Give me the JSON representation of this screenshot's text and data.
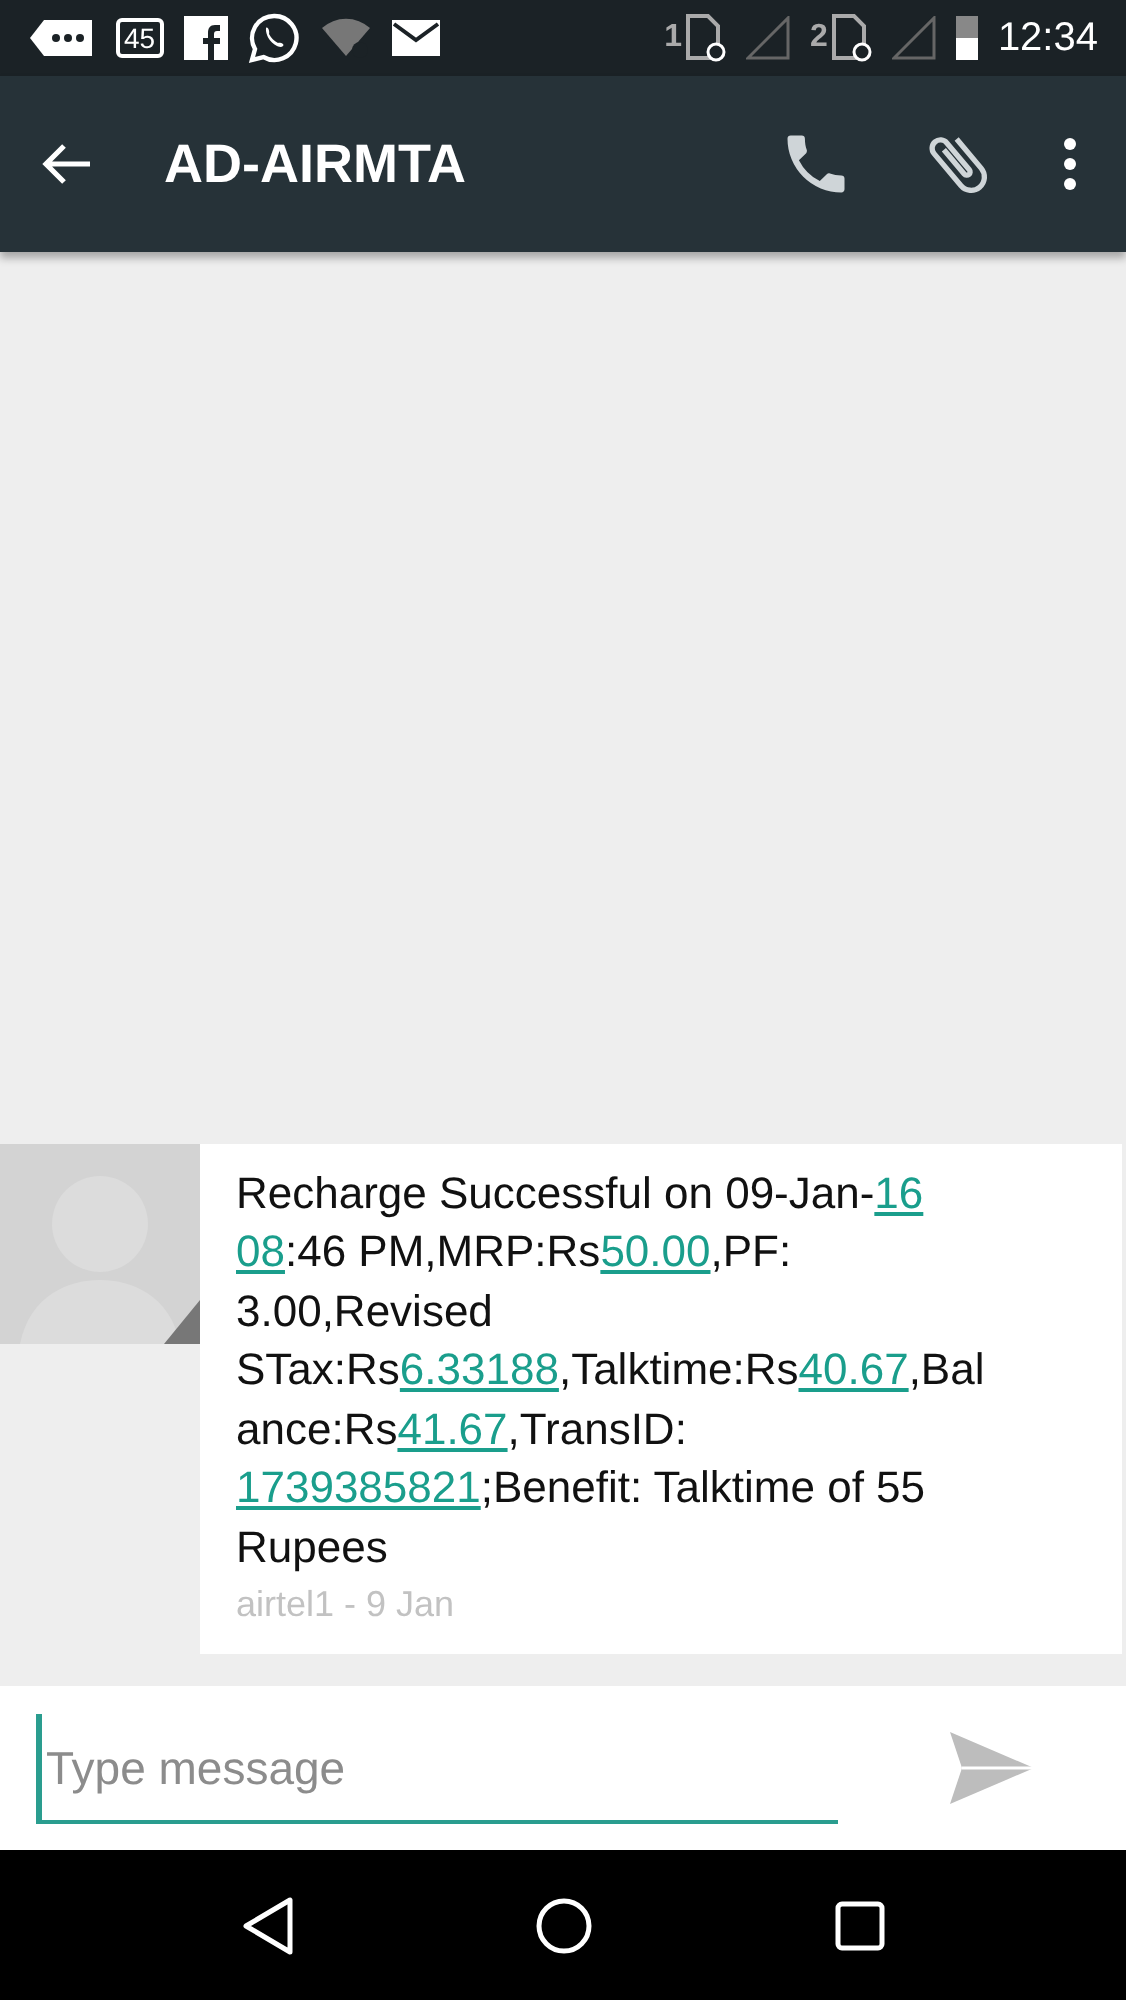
{
  "status_bar": {
    "notification_badge": "45",
    "sim_1": "1",
    "sim_2": "2",
    "time": "12:34"
  },
  "app_bar": {
    "title": "AD-AIRMTA"
  },
  "message": {
    "lines": [
      [
        {
          "text": "Recharge Successful on 09-Jan-",
          "link": false
        },
        {
          "text": "16",
          "link": true
        }
      ],
      [
        {
          "text": "08",
          "link": true
        },
        {
          "text": ":46 PM,MRP:Rs",
          "link": false
        },
        {
          "text": "50.00",
          "link": true
        },
        {
          "text": ",PF:",
          "link": false
        }
      ],
      [
        {
          "text": "3.00,Revised",
          "link": false
        }
      ],
      [
        {
          "text": "STax:Rs",
          "link": false
        },
        {
          "text": "6.33188",
          "link": true
        },
        {
          "text": ",Talktime:Rs",
          "link": false
        },
        {
          "text": "40.67",
          "link": true
        },
        {
          "text": ",Bal",
          "link": false
        }
      ],
      [
        {
          "text": "ance:Rs",
          "link": false
        },
        {
          "text": "41.67",
          "link": true
        },
        {
          "text": ",TransID:",
          "link": false
        }
      ],
      [
        {
          "text": "1739385821",
          "link": true
        },
        {
          "text": ";Benefit: Talktime of 55",
          "link": false
        }
      ],
      [
        {
          "text": "Rupees",
          "link": false
        }
      ]
    ],
    "meta": "airtel1 - 9 Jan"
  },
  "compose": {
    "placeholder": "Type message"
  }
}
